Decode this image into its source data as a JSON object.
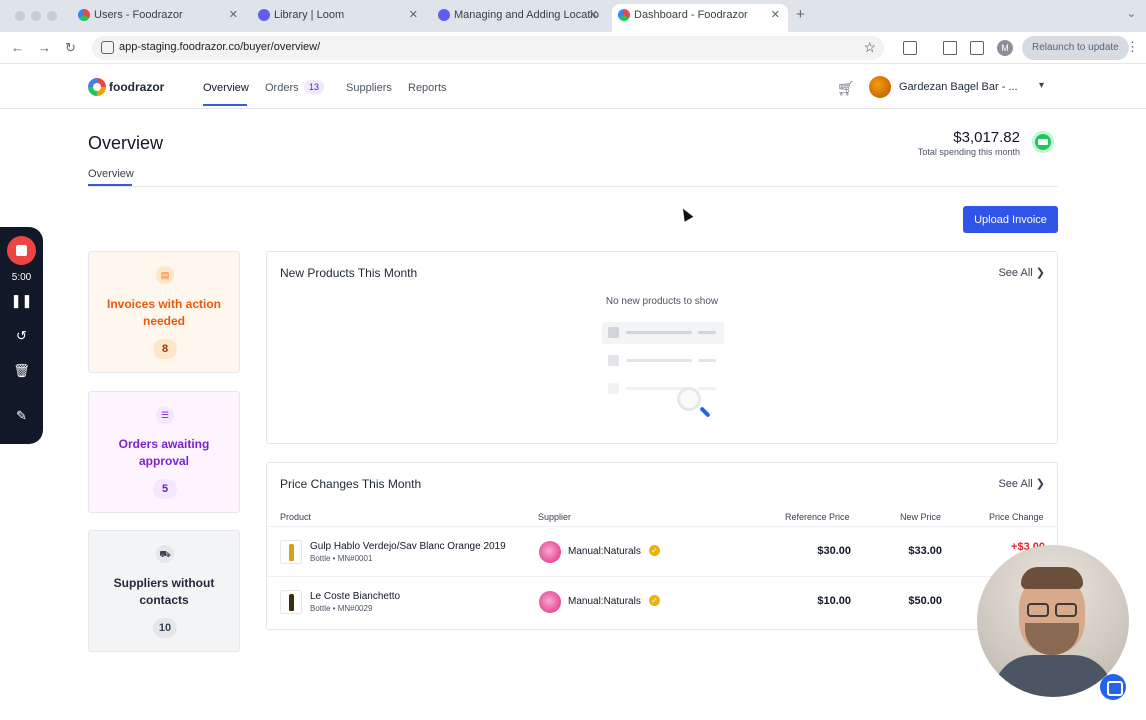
{
  "browser": {
    "tabs": [
      {
        "title": "Users - Foodrazor"
      },
      {
        "title": "Library | Loom"
      },
      {
        "title": "Managing and Adding Locatio"
      },
      {
        "title": "Dashboard - Foodrazor"
      }
    ],
    "url": "app-staging.foodrazor.co/buyer/overview/",
    "profile_initial": "M",
    "relaunch_label": "Relaunch to update"
  },
  "app": {
    "logo": "foodrazor",
    "nav": [
      {
        "label": "Overview"
      },
      {
        "label": "Orders",
        "badge": "13"
      },
      {
        "label": "Suppliers"
      },
      {
        "label": "Reports"
      }
    ],
    "business_name": "Gardezan Bagel Bar - ..."
  },
  "header": {
    "title": "Overview",
    "subtab": "Overview",
    "spending_amount": "$3,017.82",
    "spending_label": "Total spending this month",
    "upload_label": "Upload Invoice"
  },
  "recorder": {
    "time": "5:00"
  },
  "cards": [
    {
      "title": "Invoices with action needed",
      "count": "8",
      "icon": "invoice-icon",
      "color": "#ea580c"
    },
    {
      "title": "Orders awaiting approval",
      "count": "5",
      "icon": "list-icon",
      "color": "#7e22ce"
    },
    {
      "title": "Suppliers without contacts",
      "count": "10",
      "icon": "truck-icon",
      "color": "#1f2937"
    }
  ],
  "new_products": {
    "title": "New Products This Month",
    "see_all": "See All",
    "empty_text": "No new products to show"
  },
  "price_changes": {
    "title": "Price Changes This Month",
    "see_all": "See All",
    "columns": {
      "product": "Product",
      "supplier": "Supplier",
      "reference_price": "Reference Price",
      "new_price": "New Price",
      "price_change": "Price Change"
    },
    "rows": [
      {
        "product": "Gulp Hablo Verdejo/Sav Blanc Orange 2019",
        "meta": "Bottle • MN#0001",
        "supplier": "Manual:Naturals",
        "reference_price": "$30.00",
        "new_price": "$33.00",
        "change": "+$3.00"
      },
      {
        "product": "Le Coste Bianchetto",
        "meta": "Bottle • MN#0029",
        "supplier": "Manual:Naturals",
        "reference_price": "$10.00",
        "new_price": "$50.00",
        "change": ""
      }
    ]
  },
  "colors": {
    "accent": "#2f54e8",
    "negative": "#dc2626"
  }
}
